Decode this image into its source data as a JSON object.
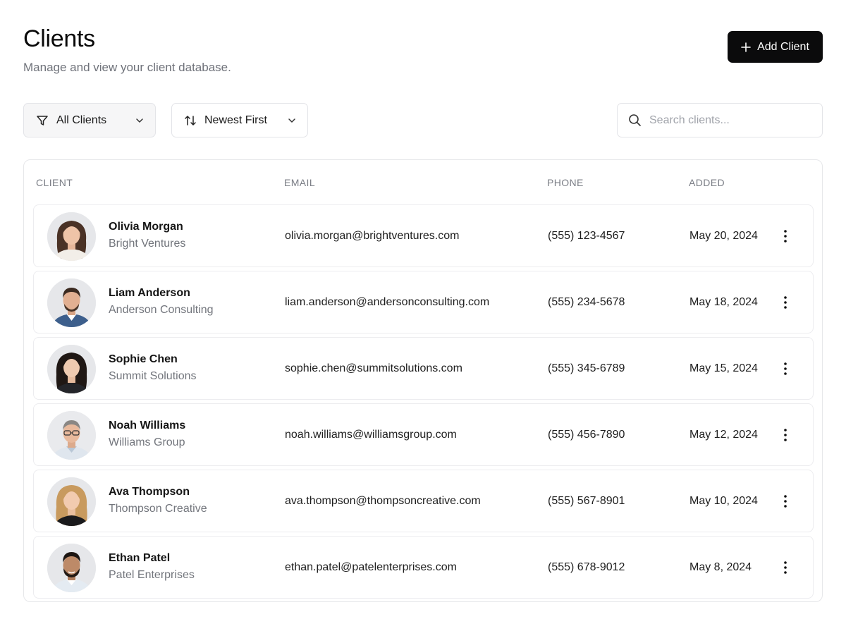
{
  "header": {
    "title": "Clients",
    "subtitle": "Manage and view your client database."
  },
  "actions": {
    "add_label": "Add Client",
    "add_icon": "plus-icon"
  },
  "filters": {
    "filter_label": "All Clients",
    "filter_icon": "filter-icon",
    "sort_label": "Newest First",
    "sort_icon": "sort-arrows-icon",
    "search_placeholder": "Search clients...",
    "search_value": ""
  },
  "table": {
    "columns": [
      "CLIENT",
      "EMAIL",
      "PHONE",
      "ADDED"
    ],
    "rows": [
      {
        "name": "Olivia Morgan",
        "company": "Bright Ventures",
        "email": "olivia.morgan@brightventures.com",
        "phone": "(555) 123-4567",
        "added": "May 20, 2024"
      },
      {
        "name": "Liam Anderson",
        "company": "Anderson Consulting",
        "email": "liam.anderson@andersonconsulting.com",
        "phone": "(555) 234-5678",
        "added": "May 18, 2024"
      },
      {
        "name": "Sophie Chen",
        "company": "Summit Solutions",
        "email": "sophie.chen@summitsolutions.com",
        "phone": "(555) 345-6789",
        "added": "May 15, 2024"
      },
      {
        "name": "Noah Williams",
        "company": "Williams Group",
        "email": "noah.williams@williamsgroup.com",
        "phone": "(555) 456-7890",
        "added": "May 12, 2024"
      },
      {
        "name": "Ava Thompson",
        "company": "Thompson Creative",
        "email": "ava.thompson@thompsoncreative.com",
        "phone": "(555) 567-8901",
        "added": "May 10, 2024"
      },
      {
        "name": "Ethan Patel",
        "company": "Patel Enterprises",
        "email": "ethan.patel@patelenterprises.com",
        "phone": "(555) 678-9012",
        "added": "May 8, 2024"
      }
    ]
  },
  "colors": {
    "primary_button": "#0b0b0c",
    "border": "#e6e7ea",
    "muted_text": "#72757c"
  }
}
